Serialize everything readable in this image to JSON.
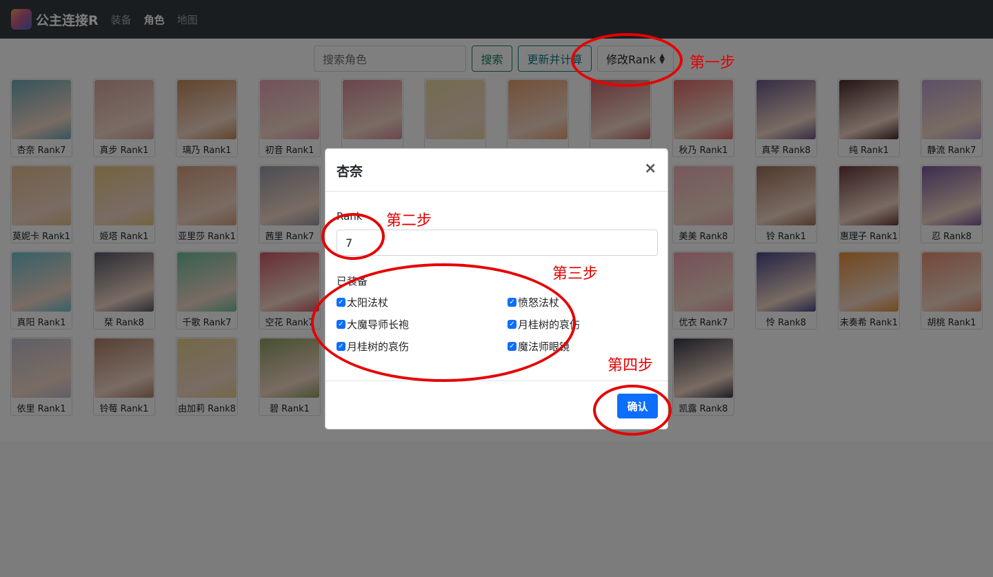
{
  "navbar": {
    "brand": "公主连接R",
    "links": [
      {
        "label": "装备",
        "active": false
      },
      {
        "label": "角色",
        "active": true
      },
      {
        "label": "地图",
        "active": false
      }
    ]
  },
  "toolbar": {
    "search_placeholder": "搜索角色",
    "search_button": "搜索",
    "update_button": "更新并计算",
    "rank_select": "修改Rank"
  },
  "characters": [
    {
      "label": "杏奈 Rank7",
      "color": "#6fa8b8"
    },
    {
      "label": "真步 Rank1",
      "color": "#d9a7a0"
    },
    {
      "label": "璃乃 Rank1",
      "color": "#c58a5a"
    },
    {
      "label": "初音 Rank1",
      "color": "#e6a3b8"
    },
    {
      "label": "",
      "color": "#d98a9a"
    },
    {
      "label": "",
      "color": "#e8d8a0"
    },
    {
      "label": "",
      "color": "#e8a070"
    },
    {
      "label": "",
      "color": "#c86a70"
    },
    {
      "label": "秋乃 Rank1",
      "color": "#e06a6a"
    },
    {
      "label": "真琴 Rank8",
      "color": "#6a5a8a"
    },
    {
      "label": "纯 Rank1",
      "color": "#4a2a2a"
    },
    {
      "label": "静流 Rank7",
      "color": "#b8a0d0"
    },
    {
      "label": "莫妮卡 Rank1",
      "color": "#e8c090"
    },
    {
      "label": "姬塔 Rank1",
      "color": "#e8c880"
    },
    {
      "label": "亚里莎 Rank1",
      "color": "#d8a080"
    },
    {
      "label": "茜里 Rank7",
      "color": "#9a9aa8"
    },
    {
      "label": "",
      "color": "#ffffff"
    },
    {
      "label": "",
      "color": "#ffffff"
    },
    {
      "label": "",
      "color": "#ffffff"
    },
    {
      "label": "",
      "color": "#ffffff"
    },
    {
      "label": "美美 Rank8",
      "color": "#f0b0b8"
    },
    {
      "label": "铃 Rank1",
      "color": "#a0705a"
    },
    {
      "label": "惠理子 Rank1",
      "color": "#6a3a3a"
    },
    {
      "label": "忍 Rank8",
      "color": "#7a5aa0"
    },
    {
      "label": "真阳 Rank1",
      "color": "#70c0d0"
    },
    {
      "label": "栞 Rank8",
      "color": "#5a5a6a"
    },
    {
      "label": "千歌 Rank7",
      "color": "#70c0a0"
    },
    {
      "label": "空花 Rank7",
      "color": "#d05a6a"
    },
    {
      "label": "",
      "color": "#ffffff"
    },
    {
      "label": "",
      "color": "#ffffff"
    },
    {
      "label": "",
      "color": "#ffffff"
    },
    {
      "label": "",
      "color": "#ffffff"
    },
    {
      "label": "优衣 Rank7",
      "color": "#f0a0b0"
    },
    {
      "label": "怜 Rank8",
      "color": "#4a4a8a"
    },
    {
      "label": "未奏希 Rank1",
      "color": "#e8903a"
    },
    {
      "label": "胡桃 Rank1",
      "color": "#e89070"
    },
    {
      "label": "依里 Rank1",
      "color": "#c0c0d0"
    },
    {
      "label": "铃莓 Rank1",
      "color": "#b0806a"
    },
    {
      "label": "由加莉 Rank8",
      "color": "#e8d090"
    },
    {
      "label": "碧 Rank1",
      "color": "#90a060"
    },
    {
      "label": "",
      "color": "#ffffff"
    },
    {
      "label": "",
      "color": "#ffffff"
    },
    {
      "label": "",
      "color": "#ffffff"
    },
    {
      "label": "",
      "color": "#ffffff"
    },
    {
      "label": "凯露 Rank8",
      "color": "#3a3a4a"
    }
  ],
  "modal": {
    "title": "杏奈",
    "close": "×",
    "rank_label": "Rank",
    "rank_value": "7",
    "equipped_label": "已装备",
    "equipment": [
      {
        "label": "太阳法杖",
        "checked": true
      },
      {
        "label": "愤怒法杖",
        "checked": true
      },
      {
        "label": "大魔导师长袍",
        "checked": true
      },
      {
        "label": "月桂树的哀伤",
        "checked": true
      },
      {
        "label": "月桂树的哀伤",
        "checked": true
      },
      {
        "label": "魔法师眼镜",
        "checked": true
      }
    ],
    "confirm": "确认"
  },
  "annotations": {
    "step1": "第一步",
    "step2": "第二步",
    "step3": "第三步",
    "step4": "第四步",
    "color": "#e60000"
  }
}
